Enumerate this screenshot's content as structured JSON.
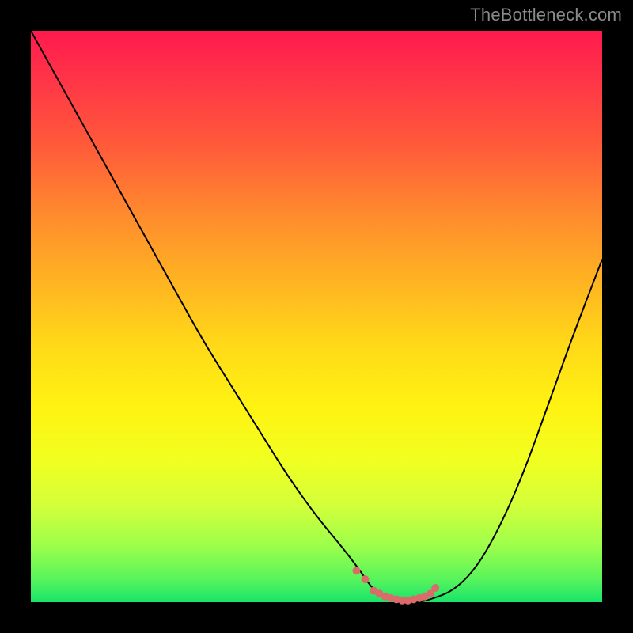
{
  "watermark": "TheBottleneck.com",
  "colors": {
    "gradient_top": "#ff1a4d",
    "gradient_mid": "#fff312",
    "gradient_bottom": "#18e46a",
    "curve": "#000000",
    "dots": "#db6b6b",
    "frame": "#000000"
  },
  "chart_data": {
    "type": "line",
    "title": "",
    "xlabel": "",
    "ylabel": "",
    "xlim": [
      0,
      100
    ],
    "ylim": [
      0,
      100
    ],
    "grid": false,
    "legend": false,
    "series": [
      {
        "name": "bottleneck-curve",
        "x": [
          0,
          5,
          10,
          15,
          20,
          25,
          30,
          35,
          40,
          45,
          50,
          55,
          58,
          60,
          63,
          66,
          68,
          70,
          74,
          78,
          82,
          86,
          90,
          95,
          100
        ],
        "y": [
          100,
          91,
          82,
          73,
          64,
          55,
          46,
          38,
          30,
          22,
          15,
          9,
          5,
          2,
          0.5,
          0,
          0,
          0.5,
          2,
          6,
          13,
          22,
          33,
          47,
          60
        ]
      }
    ],
    "highlight_points": {
      "name": "optimal-range-dots",
      "x": [
        57,
        58.5,
        60,
        61,
        62,
        63,
        64,
        65,
        66,
        67,
        68,
        69,
        70,
        70.8
      ],
      "y": [
        5.5,
        4,
        2,
        1.5,
        1,
        0.7,
        0.5,
        0.3,
        0.3,
        0.5,
        0.7,
        1,
        1.5,
        2.5
      ]
    }
  }
}
